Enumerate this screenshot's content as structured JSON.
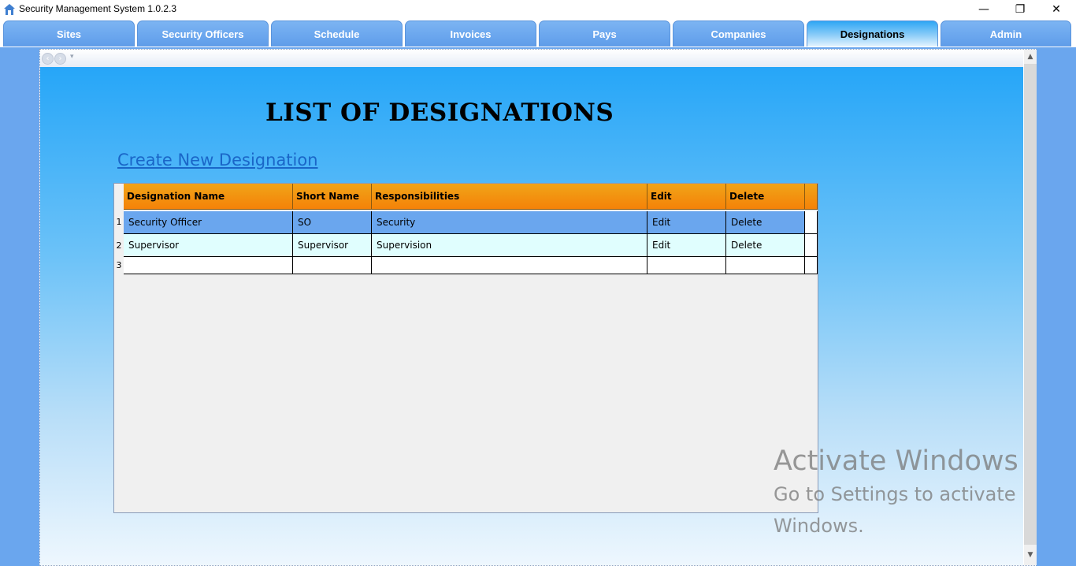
{
  "window": {
    "title": "Security Management System 1.0.2.3",
    "minimize": "—",
    "maximize": "❐",
    "close": "✕"
  },
  "tabs": [
    {
      "label": "Sites"
    },
    {
      "label": "Security Officers"
    },
    {
      "label": "Schedule"
    },
    {
      "label": "Invoices"
    },
    {
      "label": "Pays"
    },
    {
      "label": "Companies"
    },
    {
      "label": "Designations",
      "active": true
    },
    {
      "label": "Admin"
    }
  ],
  "page": {
    "title": "LIST OF DESIGNATIONS",
    "create_link": "Create New Designation"
  },
  "grid": {
    "columns": [
      "Designation Name",
      "Short Name",
      "Responsibilities",
      "Edit",
      "Delete"
    ],
    "rows": [
      {
        "index": "1",
        "name": "Security Officer",
        "short": "SO",
        "resp": "Security",
        "edit": "Edit",
        "delete": "Delete",
        "selected": true
      },
      {
        "index": "2",
        "name": "Supervisor",
        "short": "Supervisor",
        "resp": "Supervision",
        "edit": "Edit",
        "delete": "Delete"
      },
      {
        "index": "3",
        "name": "",
        "short": "",
        "resp": "",
        "edit": "",
        "delete": ""
      }
    ]
  },
  "watermark": {
    "line1": "Activate Windows",
    "line2": "Go to Settings to activate",
    "line3": "Windows."
  },
  "icons": {
    "app": "house-icon",
    "back": "back-arrow-icon",
    "forward": "forward-arrow-icon"
  }
}
